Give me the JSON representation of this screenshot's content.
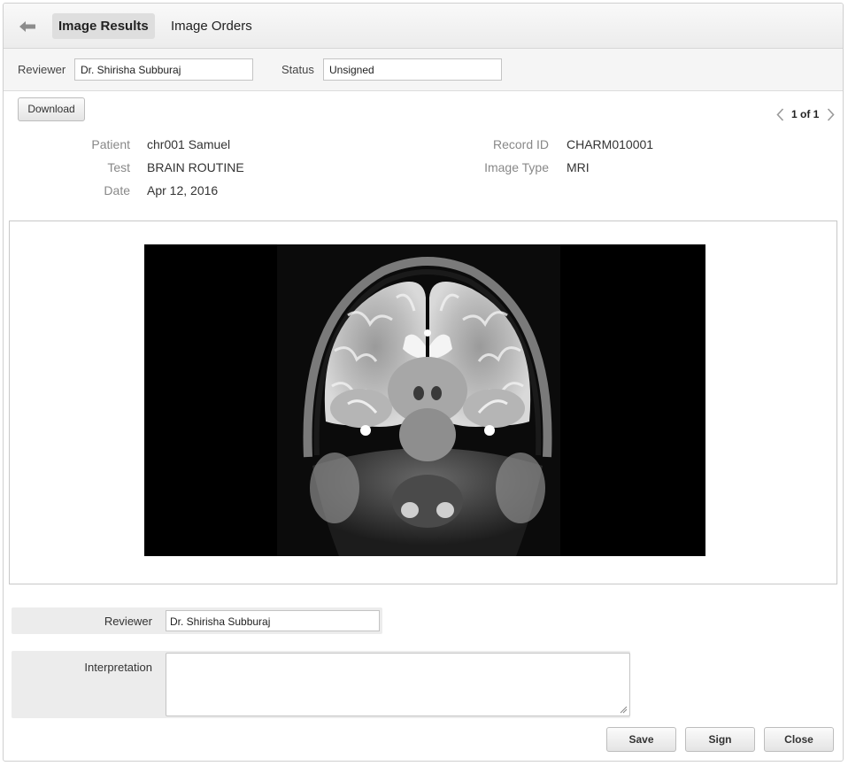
{
  "nav": {
    "back_icon": "back-arrow-icon",
    "tabs": [
      {
        "label": "Image Results",
        "active": true
      },
      {
        "label": "Image Orders",
        "active": false
      }
    ]
  },
  "filters": {
    "reviewer_label": "Reviewer",
    "reviewer_value": "Dr. Shirisha Subburaj",
    "status_label": "Status",
    "status_value": "Unsigned"
  },
  "toolbar": {
    "download_label": "Download",
    "pager_text": "1 of 1"
  },
  "record": {
    "patient_label": "Patient",
    "patient_value": "chr001 Samuel",
    "test_label": "Test",
    "test_value": "BRAIN ROUTINE",
    "date_label": "Date",
    "date_value": "Apr 12, 2016",
    "record_id_label": "Record ID",
    "record_id_value": "CHARM010001",
    "image_type_label": "Image Type",
    "image_type_value": "MRI"
  },
  "form": {
    "reviewer_label": "Reviewer",
    "reviewer_value": "Dr. Shirisha Subburaj",
    "interpretation_label": "Interpretation",
    "interpretation_value": ""
  },
  "actions": {
    "save_label": "Save",
    "sign_label": "Sign",
    "close_label": "Close"
  },
  "colors": {
    "topbar": "#ececec",
    "active_tab": "#dedede",
    "image_bg": "#000000"
  }
}
